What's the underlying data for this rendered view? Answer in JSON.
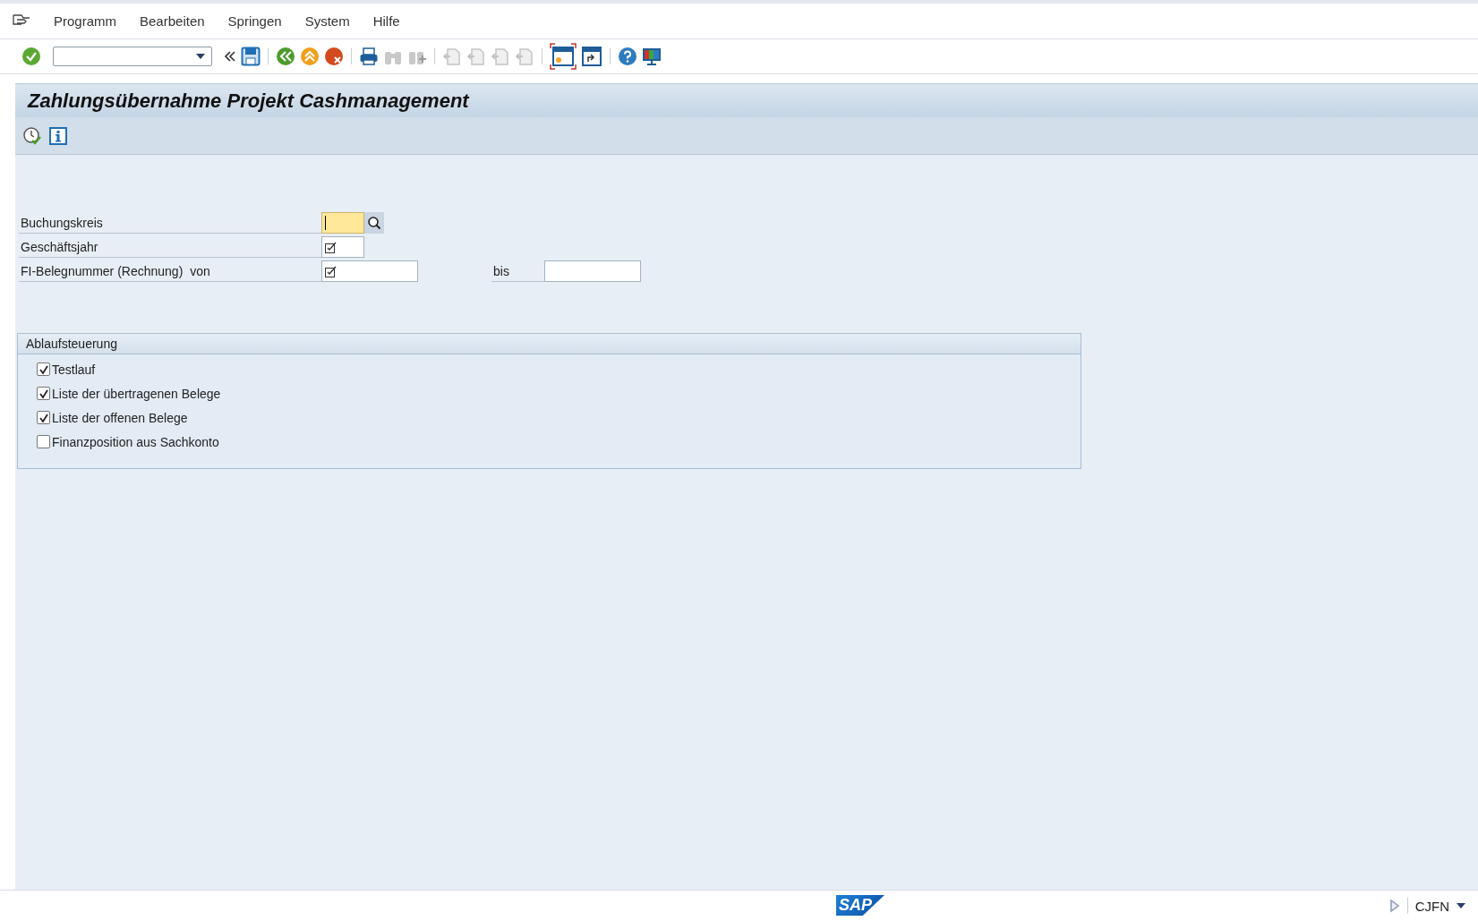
{
  "menu": [
    "Programm",
    "Bearbeiten",
    "Springen",
    "System",
    "Hilfe"
  ],
  "title": "Zahlungsübernahme Projekt Cashmanagement",
  "fields": [
    {
      "kind": "code",
      "label": "Buchungskreis",
      "focused": true,
      "required": false
    },
    {
      "kind": "year",
      "label": "Geschäftsjahr",
      "focused": false,
      "required": true
    },
    {
      "kind": "range",
      "label": "FI-Belegnummer (Rechnung)",
      "suffix": "von",
      "to_label": "bis",
      "focused": false,
      "required": true
    }
  ],
  "group": {
    "title": "Ablaufsteuerung",
    "options": [
      {
        "label": "Testlauf",
        "checked": true
      },
      {
        "label": "Liste der übertragenen Belege",
        "checked": true
      },
      {
        "label": "Liste der offenen Belege",
        "checked": true
      },
      {
        "label": "Finanzposition aus Sachkonto",
        "checked": false
      }
    ]
  },
  "status_bar": {
    "logo": "SAP",
    "transaction": "CJFN"
  }
}
